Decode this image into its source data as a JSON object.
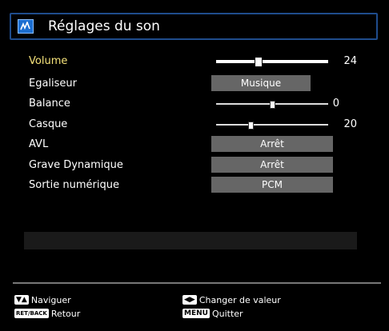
{
  "title": "Réglages du son",
  "title_icon": "sound-settings-icon",
  "rows": {
    "volume": {
      "label": "Volume",
      "value": "24",
      "level": 0.37
    },
    "egaliseur": {
      "label": "Egaliseur",
      "value": "Musique"
    },
    "balance": {
      "label": "Balance",
      "value": "0",
      "level": 0.5
    },
    "casque": {
      "label": "Casque",
      "value": "20",
      "level": 0.3
    },
    "avl": {
      "label": "AVL",
      "value": "Arrêt"
    },
    "grave": {
      "label": "Grave Dynamique",
      "value": "Arrêt"
    },
    "sortie": {
      "label": "Sortie numérique",
      "value": "PCM"
    }
  },
  "footer": {
    "navigate": {
      "key": "▼▲",
      "label": "Naviguer"
    },
    "back": {
      "key": "RET/BACK",
      "label": "Retour"
    },
    "change": {
      "key": "◀▶",
      "label": "Changer de valeur"
    },
    "quit": {
      "key": "MENU",
      "label": "Quitter"
    }
  },
  "colors": {
    "active_label": "#f5e27a",
    "title_border": "#1f4c8c",
    "option_box": "#666666"
  }
}
